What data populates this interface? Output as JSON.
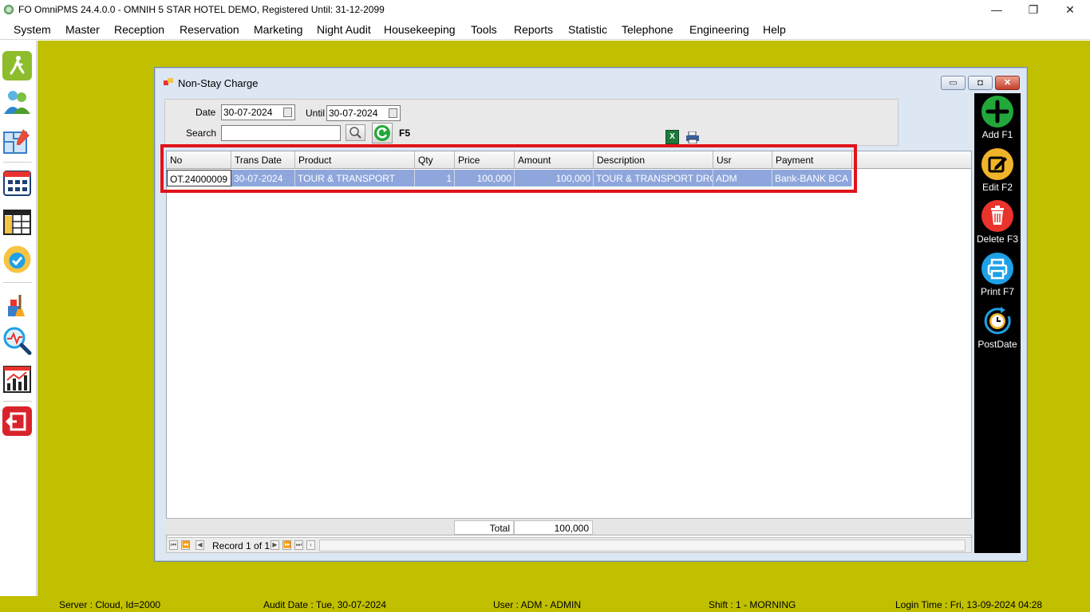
{
  "window": {
    "title": "FO OmniPMS 24.4.0.0 - OMNIH 5 STAR HOTEL DEMO, Registered Until: 31-12-2099",
    "minimize": "—",
    "restore": "❐",
    "close": "✕"
  },
  "menu": {
    "items": [
      "System",
      "Master",
      "Reception",
      "Reservation",
      "Marketing",
      "Night Audit",
      "Housekeeping",
      "Tools",
      "Reports",
      "Statistic",
      "Telephone",
      "Engineering",
      "Help"
    ]
  },
  "sidebar": {
    "icons": [
      "walk-in-icon",
      "guests-icon",
      "floor-plan-icon",
      "room-grid-icon",
      "calendar-icon",
      "availability-icon",
      "housekeeping-icon",
      "analysis-icon",
      "statistics-icon",
      "exit-icon"
    ]
  },
  "dialog": {
    "title": "Non-Stay Charge",
    "filter": {
      "date_label": "Date",
      "date_value": "30-07-2024",
      "until_label": "Until",
      "until_value": "30-07-2024",
      "search_label": "Search",
      "search_value": "",
      "refresh_hotkey": "F5"
    },
    "grid": {
      "columns": [
        "No",
        "Trans Date",
        "Product",
        "Qty",
        "Price",
        "Amount",
        "Description",
        "Usr",
        "Payment"
      ],
      "rows": [
        {
          "no": "OT.24000009",
          "trans_date": "30-07-2024",
          "product": "TOUR & TRANSPORT",
          "qty": "1",
          "price": "100,000",
          "amount": "100,000",
          "description": "TOUR & TRANSPORT DROP…",
          "usr": "ADM",
          "payment": "Bank-BANK BCA"
        }
      ],
      "footer": {
        "total_label": "Total",
        "total_value": "100,000"
      },
      "navigator": {
        "record_text": "Record 1 of 1"
      }
    },
    "actions": {
      "add": "Add F1",
      "edit": "Edit F2",
      "delete": "Delete F3",
      "print": "Print F7",
      "postdate": "PostDate"
    }
  },
  "status": {
    "server": "Server : Cloud, Id=2000",
    "audit_date": "Audit Date : Tue, 30-07-2024",
    "user": "User : ADM - ADMIN",
    "shift": "Shift : 1 - MORNING",
    "login_time": "Login Time : Fri, 13-09-2024 04:28"
  },
  "colors": {
    "workspace": "#c0c000",
    "selected_row": "#8ea6dc",
    "highlight_box": "#e0141a",
    "add": "#22a83a",
    "edit": "#f0b428",
    "delete": "#e8342c",
    "print": "#1ea0e6"
  }
}
